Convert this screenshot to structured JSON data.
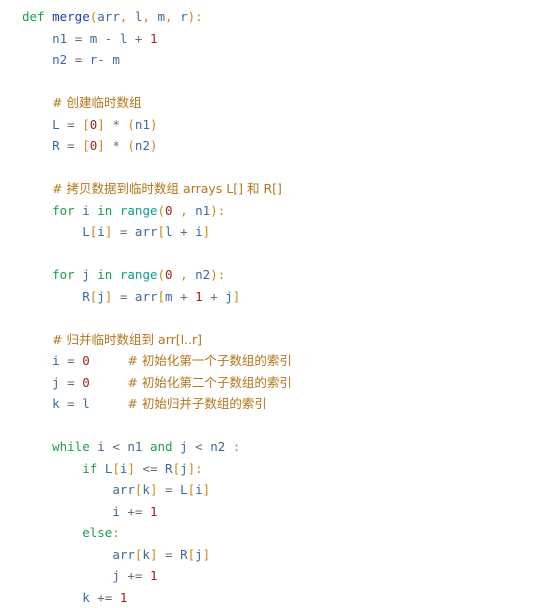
{
  "editor": {
    "background_color": "#ffffff",
    "language": "python",
    "theme_colors": {
      "keyword": "#1a9e4b",
      "function_name": "#1b3faa",
      "builtin": "#0f9d8a",
      "identifier": "#3d6a9e",
      "number": "#98251f",
      "punctuation": "#c98a12",
      "operator": "#6a6a6a",
      "comment": "#b5761a",
      "plain": "#2b2b2b"
    }
  },
  "code": {
    "lines": [
      {
        "indent": 0,
        "tokens": [
          {
            "text": "def",
            "type": "kw"
          },
          {
            "text": " ",
            "type": "plain"
          },
          {
            "text": "merge",
            "type": "fn"
          },
          {
            "text": "(",
            "type": "punc"
          },
          {
            "text": "arr",
            "type": "id"
          },
          {
            "text": ", ",
            "type": "punc"
          },
          {
            "text": "l",
            "type": "id"
          },
          {
            "text": ", ",
            "type": "punc"
          },
          {
            "text": "m",
            "type": "id"
          },
          {
            "text": ", ",
            "type": "punc"
          },
          {
            "text": "r",
            "type": "id"
          },
          {
            "text": ")",
            "type": "punc"
          },
          {
            "text": ":",
            "type": "punc"
          }
        ]
      },
      {
        "indent": 1,
        "tokens": [
          {
            "text": "n1",
            "type": "id"
          },
          {
            "text": " = ",
            "type": "op"
          },
          {
            "text": "m",
            "type": "id"
          },
          {
            "text": " - ",
            "type": "op"
          },
          {
            "text": "l",
            "type": "id"
          },
          {
            "text": " + ",
            "type": "op"
          },
          {
            "text": "1",
            "type": "num"
          }
        ]
      },
      {
        "indent": 1,
        "tokens": [
          {
            "text": "n2",
            "type": "id"
          },
          {
            "text": " = ",
            "type": "op"
          },
          {
            "text": "r",
            "type": "id"
          },
          {
            "text": "- ",
            "type": "op"
          },
          {
            "text": "m",
            "type": "id"
          }
        ]
      },
      {
        "indent": 0,
        "tokens": []
      },
      {
        "indent": 1,
        "tokens": [
          {
            "text": "# 创建临时数组",
            "type": "comment"
          }
        ]
      },
      {
        "indent": 1,
        "tokens": [
          {
            "text": "L",
            "type": "id"
          },
          {
            "text": " = ",
            "type": "op"
          },
          {
            "text": "[",
            "type": "punc"
          },
          {
            "text": "0",
            "type": "num"
          },
          {
            "text": "]",
            "type": "punc"
          },
          {
            "text": " * ",
            "type": "op"
          },
          {
            "text": "(",
            "type": "punc"
          },
          {
            "text": "n1",
            "type": "id"
          },
          {
            "text": ")",
            "type": "punc"
          }
        ]
      },
      {
        "indent": 1,
        "tokens": [
          {
            "text": "R",
            "type": "id"
          },
          {
            "text": " = ",
            "type": "op"
          },
          {
            "text": "[",
            "type": "punc"
          },
          {
            "text": "0",
            "type": "num"
          },
          {
            "text": "]",
            "type": "punc"
          },
          {
            "text": " * ",
            "type": "op"
          },
          {
            "text": "(",
            "type": "punc"
          },
          {
            "text": "n2",
            "type": "id"
          },
          {
            "text": ")",
            "type": "punc"
          }
        ]
      },
      {
        "indent": 0,
        "tokens": []
      },
      {
        "indent": 1,
        "tokens": [
          {
            "text": "# 拷贝数据到临时数组 arrays L[] 和 R[]",
            "type": "comment"
          }
        ]
      },
      {
        "indent": 1,
        "tokens": [
          {
            "text": "for",
            "type": "kw"
          },
          {
            "text": " ",
            "type": "plain"
          },
          {
            "text": "i",
            "type": "id"
          },
          {
            "text": " ",
            "type": "plain"
          },
          {
            "text": "in",
            "type": "kw"
          },
          {
            "text": " ",
            "type": "plain"
          },
          {
            "text": "range",
            "type": "builtin"
          },
          {
            "text": "(",
            "type": "punc"
          },
          {
            "text": "0",
            "type": "num"
          },
          {
            "text": " , ",
            "type": "punc"
          },
          {
            "text": "n1",
            "type": "id"
          },
          {
            "text": ")",
            "type": "punc"
          },
          {
            "text": ":",
            "type": "punc"
          }
        ]
      },
      {
        "indent": 2,
        "tokens": [
          {
            "text": "L",
            "type": "id"
          },
          {
            "text": "[",
            "type": "punc"
          },
          {
            "text": "i",
            "type": "id"
          },
          {
            "text": "]",
            "type": "punc"
          },
          {
            "text": " = ",
            "type": "op"
          },
          {
            "text": "arr",
            "type": "id"
          },
          {
            "text": "[",
            "type": "punc"
          },
          {
            "text": "l",
            "type": "id"
          },
          {
            "text": " + ",
            "type": "op"
          },
          {
            "text": "i",
            "type": "id"
          },
          {
            "text": "]",
            "type": "punc"
          }
        ]
      },
      {
        "indent": 0,
        "tokens": []
      },
      {
        "indent": 1,
        "tokens": [
          {
            "text": "for",
            "type": "kw"
          },
          {
            "text": " ",
            "type": "plain"
          },
          {
            "text": "j",
            "type": "id"
          },
          {
            "text": " ",
            "type": "plain"
          },
          {
            "text": "in",
            "type": "kw"
          },
          {
            "text": " ",
            "type": "plain"
          },
          {
            "text": "range",
            "type": "builtin"
          },
          {
            "text": "(",
            "type": "punc"
          },
          {
            "text": "0",
            "type": "num"
          },
          {
            "text": " , ",
            "type": "punc"
          },
          {
            "text": "n2",
            "type": "id"
          },
          {
            "text": ")",
            "type": "punc"
          },
          {
            "text": ":",
            "type": "punc"
          }
        ]
      },
      {
        "indent": 2,
        "tokens": [
          {
            "text": "R",
            "type": "id"
          },
          {
            "text": "[",
            "type": "punc"
          },
          {
            "text": "j",
            "type": "id"
          },
          {
            "text": "]",
            "type": "punc"
          },
          {
            "text": " = ",
            "type": "op"
          },
          {
            "text": "arr",
            "type": "id"
          },
          {
            "text": "[",
            "type": "punc"
          },
          {
            "text": "m",
            "type": "id"
          },
          {
            "text": " + ",
            "type": "op"
          },
          {
            "text": "1",
            "type": "num"
          },
          {
            "text": " + ",
            "type": "op"
          },
          {
            "text": "j",
            "type": "id"
          },
          {
            "text": "]",
            "type": "punc"
          }
        ]
      },
      {
        "indent": 0,
        "tokens": []
      },
      {
        "indent": 1,
        "tokens": [
          {
            "text": "# 归并临时数组到 arr[l..r]",
            "type": "comment"
          }
        ]
      },
      {
        "indent": 1,
        "tokens": [
          {
            "text": "i",
            "type": "id"
          },
          {
            "text": " = ",
            "type": "op"
          },
          {
            "text": "0",
            "type": "num"
          },
          {
            "text": "     ",
            "type": "plain"
          },
          {
            "text": "# 初始化第一个子数组的索引",
            "type": "comment"
          }
        ]
      },
      {
        "indent": 1,
        "tokens": [
          {
            "text": "j",
            "type": "id"
          },
          {
            "text": " = ",
            "type": "op"
          },
          {
            "text": "0",
            "type": "num"
          },
          {
            "text": "     ",
            "type": "plain"
          },
          {
            "text": "# 初始化第二个子数组的索引",
            "type": "comment"
          }
        ]
      },
      {
        "indent": 1,
        "tokens": [
          {
            "text": "k",
            "type": "id"
          },
          {
            "text": " = ",
            "type": "op"
          },
          {
            "text": "l",
            "type": "id"
          },
          {
            "text": "     ",
            "type": "plain"
          },
          {
            "text": "# 初始归并子数组的索引",
            "type": "comment"
          }
        ]
      },
      {
        "indent": 0,
        "tokens": []
      },
      {
        "indent": 1,
        "tokens": [
          {
            "text": "while",
            "type": "kw"
          },
          {
            "text": " ",
            "type": "plain"
          },
          {
            "text": "i",
            "type": "id"
          },
          {
            "text": " < ",
            "type": "op"
          },
          {
            "text": "n1",
            "type": "id"
          },
          {
            "text": " ",
            "type": "plain"
          },
          {
            "text": "and",
            "type": "kw"
          },
          {
            "text": " ",
            "type": "plain"
          },
          {
            "text": "j",
            "type": "id"
          },
          {
            "text": " < ",
            "type": "op"
          },
          {
            "text": "n2",
            "type": "id"
          },
          {
            "text": " :",
            "type": "punc"
          }
        ]
      },
      {
        "indent": 2,
        "tokens": [
          {
            "text": "if",
            "type": "kw"
          },
          {
            "text": " ",
            "type": "plain"
          },
          {
            "text": "L",
            "type": "id"
          },
          {
            "text": "[",
            "type": "punc"
          },
          {
            "text": "i",
            "type": "id"
          },
          {
            "text": "]",
            "type": "punc"
          },
          {
            "text": " <= ",
            "type": "op"
          },
          {
            "text": "R",
            "type": "id"
          },
          {
            "text": "[",
            "type": "punc"
          },
          {
            "text": "j",
            "type": "id"
          },
          {
            "text": "]",
            "type": "punc"
          },
          {
            "text": ":",
            "type": "punc"
          }
        ]
      },
      {
        "indent": 3,
        "tokens": [
          {
            "text": "arr",
            "type": "id"
          },
          {
            "text": "[",
            "type": "punc"
          },
          {
            "text": "k",
            "type": "id"
          },
          {
            "text": "]",
            "type": "punc"
          },
          {
            "text": " = ",
            "type": "op"
          },
          {
            "text": "L",
            "type": "id"
          },
          {
            "text": "[",
            "type": "punc"
          },
          {
            "text": "i",
            "type": "id"
          },
          {
            "text": "]",
            "type": "punc"
          }
        ]
      },
      {
        "indent": 3,
        "tokens": [
          {
            "text": "i",
            "type": "id"
          },
          {
            "text": " += ",
            "type": "op"
          },
          {
            "text": "1",
            "type": "num"
          }
        ]
      },
      {
        "indent": 2,
        "tokens": [
          {
            "text": "else",
            "type": "kw"
          },
          {
            "text": ":",
            "type": "punc"
          }
        ]
      },
      {
        "indent": 3,
        "tokens": [
          {
            "text": "arr",
            "type": "id"
          },
          {
            "text": "[",
            "type": "punc"
          },
          {
            "text": "k",
            "type": "id"
          },
          {
            "text": "]",
            "type": "punc"
          },
          {
            "text": " = ",
            "type": "op"
          },
          {
            "text": "R",
            "type": "id"
          },
          {
            "text": "[",
            "type": "punc"
          },
          {
            "text": "j",
            "type": "id"
          },
          {
            "text": "]",
            "type": "punc"
          }
        ]
      },
      {
        "indent": 3,
        "tokens": [
          {
            "text": "j",
            "type": "id"
          },
          {
            "text": " += ",
            "type": "op"
          },
          {
            "text": "1",
            "type": "num"
          }
        ]
      },
      {
        "indent": 2,
        "tokens": [
          {
            "text": "k",
            "type": "id"
          },
          {
            "text": " += ",
            "type": "op"
          },
          {
            "text": "1",
            "type": "num"
          }
        ]
      }
    ]
  }
}
